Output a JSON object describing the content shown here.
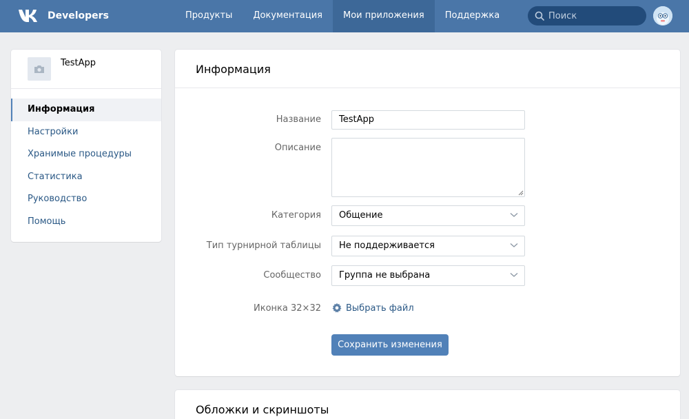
{
  "header": {
    "logo_text": "Developers",
    "nav": [
      {
        "label": "Продукты"
      },
      {
        "label": "Документация"
      },
      {
        "label": "Мои приложения",
        "active": true
      },
      {
        "label": "Поддержка"
      }
    ],
    "search_placeholder": "Поиск",
    "brand_color": "#4a76a8"
  },
  "sidebar": {
    "app_name": "TestApp",
    "items": [
      {
        "label": "Информация",
        "active": true
      },
      {
        "label": "Настройки"
      },
      {
        "label": "Хранимые процедуры"
      },
      {
        "label": "Статистика"
      },
      {
        "label": "Руководство"
      },
      {
        "label": "Помощь"
      }
    ]
  },
  "main": {
    "title": "Информация",
    "form": {
      "name_label": "Название",
      "name_value": "TestApp",
      "description_label": "Описание",
      "description_value": "",
      "category_label": "Категория",
      "category_value": "Общение",
      "leaderboard_label": "Тип турнирной таблицы",
      "leaderboard_value": "Не поддерживается",
      "community_label": "Сообщество",
      "community_value": "Группа не выбрана",
      "icon_label": "Иконка 32×32",
      "icon_action": "Выбрать файл",
      "save_label": "Сохранить изменения"
    },
    "section2_title": "Обложки и скриншоты"
  }
}
